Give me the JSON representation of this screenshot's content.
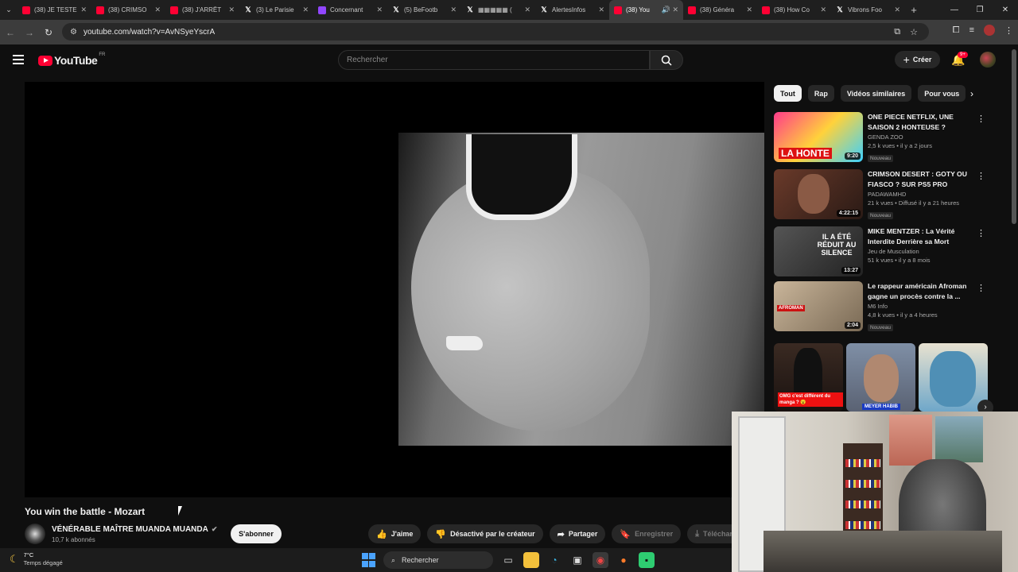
{
  "browser": {
    "tabs": [
      {
        "label": "(38) JE TESTE",
        "favicon": "youtube-icon"
      },
      {
        "label": "(38) CRIMSO",
        "favicon": "youtube-icon"
      },
      {
        "label": "(38) J'ARRÊT",
        "favicon": "youtube-icon"
      },
      {
        "label": "(3) Le Parisie",
        "favicon": "x-icon"
      },
      {
        "label": "Concernant",
        "favicon": "twitch-icon"
      },
      {
        "label": "(5) BeFootb",
        "favicon": "x-icon"
      },
      {
        "label": "▦▦▦▦▦ (",
        "favicon": "x-icon"
      },
      {
        "label": "AlertesInfos",
        "favicon": "x-icon"
      },
      {
        "label": "(38) You",
        "favicon": "youtube-icon",
        "active": true
      },
      {
        "label": "(38) Généra",
        "favicon": "youtube-icon"
      },
      {
        "label": "(38) How Co",
        "favicon": "youtube-icon"
      },
      {
        "label": "Vibrons Foo",
        "favicon": "x-icon"
      }
    ],
    "url": "youtube.com/watch?v=AvNSyeYscrA"
  },
  "header": {
    "logo_text": "YouTube",
    "country": "FR",
    "search_placeholder": "Rechercher",
    "create_label": "Créer",
    "notif_count": "9+"
  },
  "video": {
    "title": "You win the battle - Mozart",
    "channel": "VÉNÉRABLE MAÎTRE MUANDA MUANDA",
    "subscribers": "10,7 k abonnés",
    "subscribe_label": "S'abonner",
    "actions": {
      "like": "J'aime",
      "dislike": "Désactivé par le créateur",
      "share": "Partager",
      "save": "Enregistrer",
      "download": "Télécharger"
    }
  },
  "chips": [
    "Tout",
    "Rap",
    "Vidéos similaires",
    "Pour vous"
  ],
  "recommendations": [
    {
      "title": "ONE PIECE NETFLIX, UNE SAISON 2 HONTEUSE ?",
      "channel": "GENDA ZOO",
      "meta": "2,5 k vues • il y a 2 jours",
      "duration": "9:20",
      "badge": "Nouveau",
      "thumb_text": "LA HONTE"
    },
    {
      "title": "CRIMSON DESERT : GOTY OU FIASCO ? SUR PS5 PRO",
      "channel": "PADAWAMHD",
      "meta": "21 k vues • Diffusé il y a 21 heures",
      "duration": "4:22:15",
      "badge": "Nouveau"
    },
    {
      "title": "MIKE MENTZER : La Vérité Interdite Derrière sa Mort",
      "channel": "Jeu de Musculation",
      "meta": "51 k vues • il y a 8 mois",
      "duration": "13:27",
      "badge": "",
      "thumb_text": "IL A ÉTÉ RÉDUIT AU SILENCE"
    },
    {
      "title": "Le rappeur américain Afroman gagne un procès contre la ...",
      "channel": "M6 Info",
      "meta": "4,8 k vues • il y a 4 heures",
      "duration": "2:04",
      "badge": "Nouveau",
      "thumb_text": "AFROMAN"
    }
  ],
  "shorts": [
    {
      "caption": "OMG c'est différent du manga ? 😮"
    },
    {
      "caption": "MEYER HABIB"
    },
    {
      "caption": ""
    }
  ],
  "taskbar": {
    "temp": "7°C",
    "weather": "Temps dégagé",
    "search_label": "Rechercher"
  },
  "colors": {
    "accent": "#ff0033",
    "bg": "#0f0f0f",
    "chip": "#272727"
  }
}
